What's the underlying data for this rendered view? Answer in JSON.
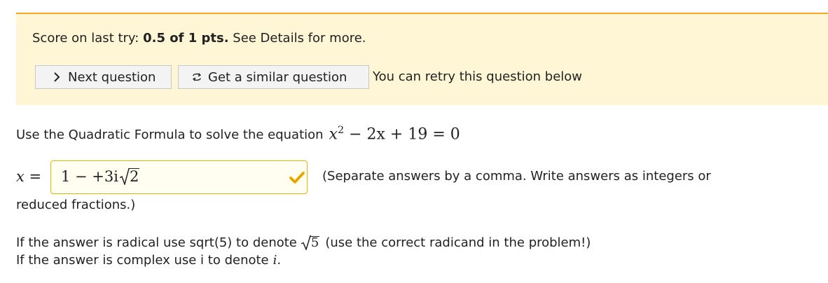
{
  "score": {
    "prefix": "Score on last try:",
    "value": "0.5 of 1 pts.",
    "suffix": "See Details for more."
  },
  "buttons": {
    "next_label": "Next question",
    "similar_label": "Get a similar question"
  },
  "retry_text": "You can retry this question below",
  "question": {
    "prompt": "Use the Quadratic Formula to solve the equation",
    "equation_var": "x",
    "equation_exp": "2",
    "equation_rest": "− 2x + 19 = 0"
  },
  "answer": {
    "label": "x =",
    "value_prefix": "1 − +3i",
    "value_radicand": "2",
    "status": "correct"
  },
  "hint": {
    "line1": "(Separate answers by a comma. Write answers as integers or",
    "line2": "reduced fractions.)"
  },
  "help": {
    "radical_prefix": "If the answer is radical use sqrt(5) to denote",
    "radical_example": "5",
    "radical_suffix": "(use the correct radicand in the problem!)",
    "complex_prefix": "If the answer is complex use i to denote",
    "complex_symbol": "i",
    "complex_suffix": "."
  },
  "colors": {
    "panel_bg": "#fff6d5",
    "panel_accent": "#f5a623",
    "answer_border": "#f0b400",
    "check": "#f0b400"
  },
  "icons": {
    "next": "chevron-right-icon",
    "similar": "retry-arrows-icon",
    "status": "checkmark-icon"
  }
}
